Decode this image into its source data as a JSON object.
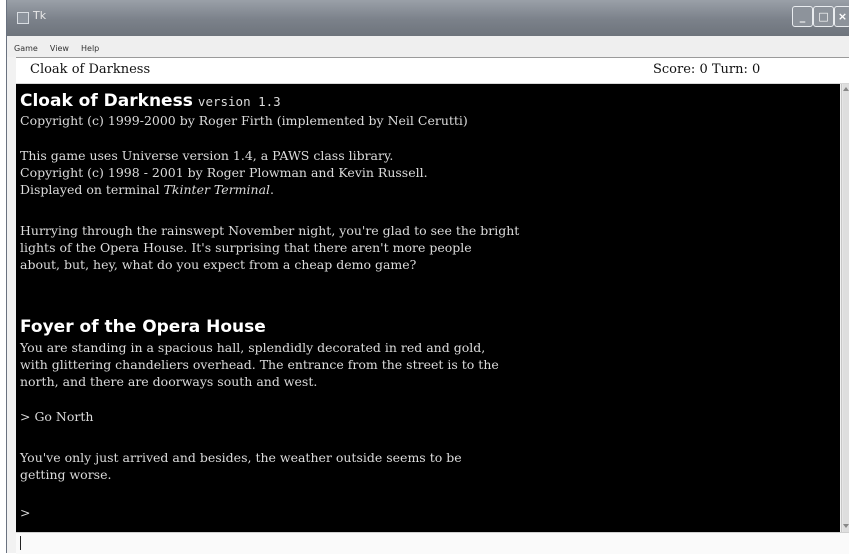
{
  "window": {
    "title": "Tk",
    "controls": {
      "minimize": "_",
      "maximize": "□",
      "close": "×"
    }
  },
  "menu": [
    "Game",
    "View",
    "Help"
  ],
  "status": {
    "game_title": "Cloak of Darkness",
    "score_label": "Score:",
    "score": "0",
    "turn_label": "Turn:",
    "turn": "0"
  },
  "terminal": {
    "banner_title": "Cloak of Darkness",
    "banner_version": "version 1.3",
    "copyright_line": "Copyright (c) 1999-2000 by Roger Firth (implemented by Neil Cerutti)",
    "universe_line1": "This game uses Universe version 1.4, a PAWS class library.",
    "universe_line2": "Copyright (c) 1998 - 2001 by Roger Plowman and Kevin Russell.",
    "displayed_prefix": "Displayed on terminal ",
    "displayed_terminal": "Tkinter Terminal",
    "displayed_suffix": ".",
    "intro_lines": [
      "Hurrying through the rainswept November night, you're glad to see the bright",
      "lights of the Opera House. It's surprising that there aren't more people",
      "about, but, hey, what do you expect from a cheap demo game?"
    ],
    "room_title": "Foyer of the Opera House",
    "room_lines": [
      "You are standing in a spacious hall, splendidly decorated in red and gold,",
      "with glittering chandeliers overhead. The entrance from the street is to the",
      "north, and there are doorways south and west."
    ],
    "command_echo": "> Go North",
    "response_lines": [
      "You've only just arrived and besides, the weather outside seems to be",
      "getting worse."
    ],
    "prompt": ">"
  }
}
